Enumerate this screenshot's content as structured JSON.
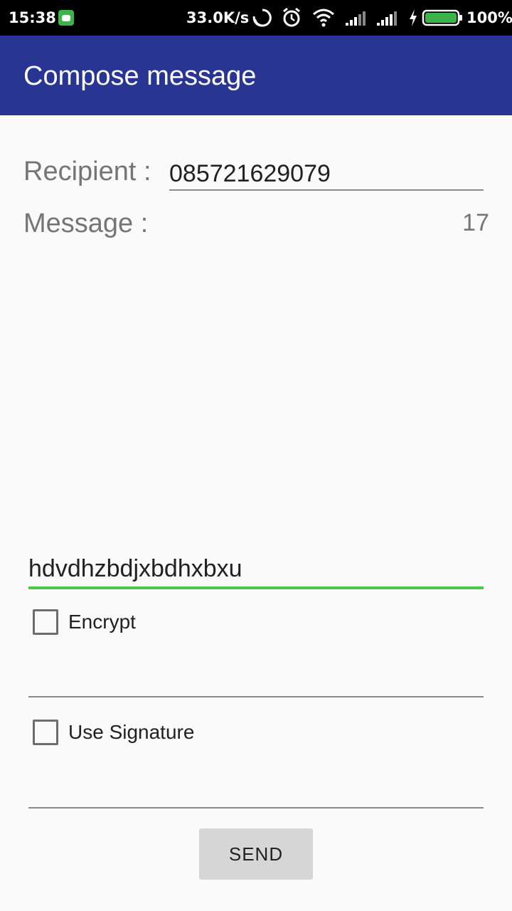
{
  "status_bar": {
    "time": "15:38",
    "net_speed": "33.0K/s",
    "battery": "100%",
    "icons": [
      "app-notification-icon",
      "sync-icon",
      "alarm-icon",
      "wifi-icon",
      "signal-icon",
      "signal-icon",
      "charging-icon",
      "battery-icon"
    ],
    "battery_color": "#3cb44a"
  },
  "app_bar": {
    "title": "Compose message",
    "color": "#283593"
  },
  "form": {
    "recipient_label": "Recipient :",
    "recipient_value": "085721629079",
    "message_label": "Message :",
    "char_count": "17",
    "message_value": "hdvdhzbdjxbdhxbxu",
    "accent_color": "#4cc94a",
    "encrypt_label": "Encrypt",
    "encrypt_checked": false,
    "signature_label": "Use Signature",
    "signature_checked": false,
    "send_label": "SEND"
  }
}
